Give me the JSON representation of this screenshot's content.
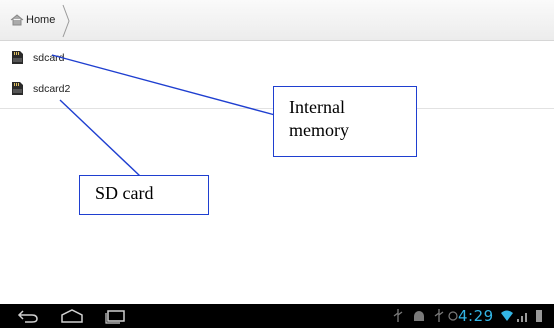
{
  "breadcrumb": {
    "home_label": "Home",
    "icon": "home-icon"
  },
  "files": [
    {
      "name": "sdcard",
      "icon": "sd-card-icon"
    },
    {
      "name": "sdcard2",
      "icon": "sd-card-icon"
    }
  ],
  "annotations": {
    "internal_line1": "Internal",
    "internal_line2": "memory",
    "sd_card": "SD card"
  },
  "status_bar": {
    "time": "4:29"
  },
  "colors": {
    "annotation_line": "#1f3fd0",
    "clock": "#33b5e5",
    "nav_bar": "#000000"
  }
}
